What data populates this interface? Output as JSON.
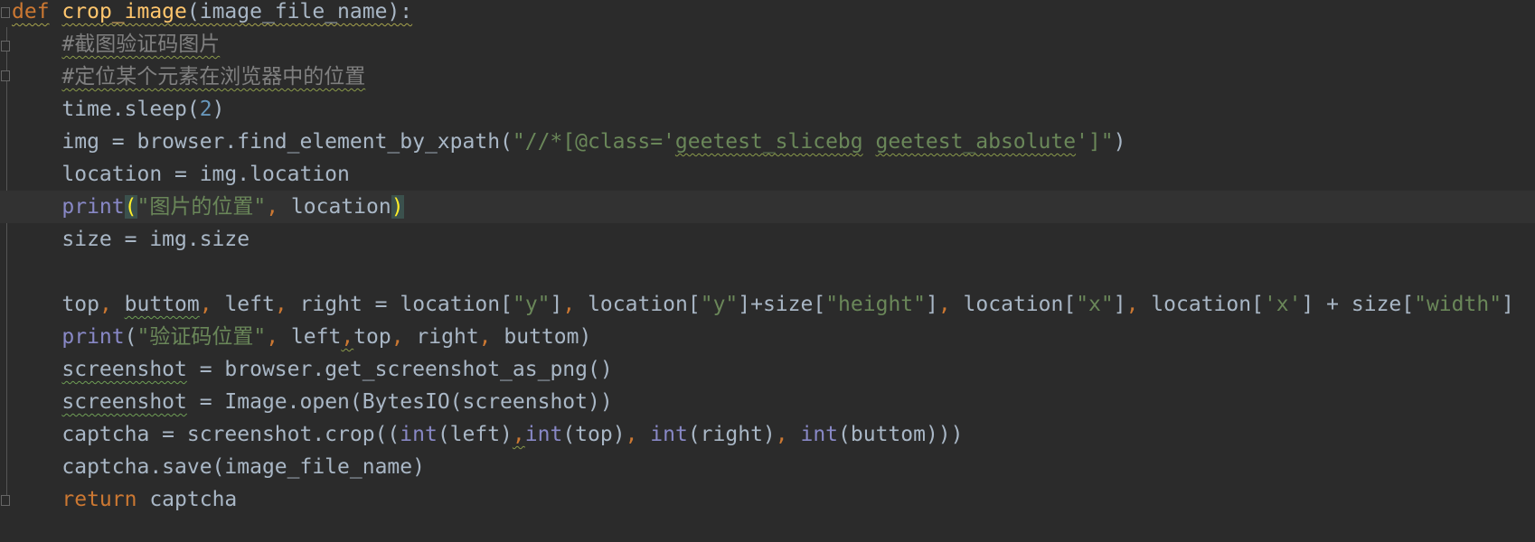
{
  "editor": {
    "language": "python",
    "theme_colors": {
      "background": "#2b2b2b",
      "current_line": "#323232",
      "keyword": "#cc7832",
      "function_name": "#ffc66d",
      "text": "#a9b7c6",
      "comment": "#808080",
      "string": "#6a8759",
      "number": "#6897bb",
      "builtin": "#8888c6",
      "brace_match": "#ffef28"
    },
    "current_line_index": 6,
    "lines": [
      [
        [
          "kw",
          "def",
          "def"
        ],
        [
          "txt",
          " "
        ],
        [
          "fn",
          "crop_image",
          "def"
        ],
        [
          "txt",
          "(image_file_name):",
          "def"
        ]
      ],
      [
        [
          "txt",
          "    "
        ],
        [
          "cm",
          "#截图验证码图片",
          "typo"
        ]
      ],
      [
        [
          "txt",
          "    "
        ],
        [
          "cm",
          "#定位某个元素在浏览器中的位置",
          "typo"
        ]
      ],
      [
        [
          "txt",
          "    time.sleep("
        ],
        [
          "num",
          "2"
        ],
        [
          "txt",
          ")"
        ]
      ],
      [
        [
          "txt",
          "    img = browser.find_element_by_xpath("
        ],
        [
          "str",
          "\"//*[@class='"
        ],
        [
          "str",
          "geetest_slicebg",
          "typo"
        ],
        [
          "str",
          " "
        ],
        [
          "str",
          "geetest_absolute",
          "typo"
        ],
        [
          "str",
          "']\""
        ],
        [
          "txt",
          ")"
        ]
      ],
      [
        [
          "txt",
          "    location = img.location"
        ]
      ],
      [
        [
          "txt",
          "    "
        ],
        [
          "bi",
          "print"
        ],
        [
          "brace",
          "("
        ],
        [
          "str",
          "\"图片的位置\""
        ],
        [
          "comma",
          ","
        ],
        [
          "txt",
          " location"
        ],
        [
          "brace",
          ")"
        ]
      ],
      [
        [
          "txt",
          "    size = img.size"
        ]
      ],
      [],
      [
        [
          "txt",
          "    top"
        ],
        [
          "comma",
          ","
        ],
        [
          "txt",
          " "
        ],
        [
          "txt",
          "buttom",
          "weak"
        ],
        [
          "comma",
          ","
        ],
        [
          "txt",
          " left"
        ],
        [
          "comma",
          ","
        ],
        [
          "txt",
          " right = location["
        ],
        [
          "str",
          "\"y\""
        ],
        [
          "txt",
          "]"
        ],
        [
          "comma",
          ","
        ],
        [
          "txt",
          " location["
        ],
        [
          "str",
          "\"y\""
        ],
        [
          "txt",
          "]+size["
        ],
        [
          "str",
          "\"height\""
        ],
        [
          "txt",
          "]"
        ],
        [
          "comma",
          ","
        ],
        [
          "txt",
          " location["
        ],
        [
          "str",
          "\"x\""
        ],
        [
          "txt",
          "]"
        ],
        [
          "comma",
          ","
        ],
        [
          "txt",
          " location["
        ],
        [
          "str",
          "'x'"
        ],
        [
          "txt",
          "] + size["
        ],
        [
          "str",
          "\"width\""
        ],
        [
          "txt",
          "]"
        ]
      ],
      [
        [
          "txt",
          "    "
        ],
        [
          "bi",
          "print"
        ],
        [
          "txt",
          "("
        ],
        [
          "str",
          "\"验证码位置\""
        ],
        [
          "comma",
          ","
        ],
        [
          "txt",
          " left"
        ],
        [
          "comma",
          ",",
          "typo"
        ],
        [
          "txt",
          "top"
        ],
        [
          "comma",
          ","
        ],
        [
          "txt",
          " right"
        ],
        [
          "comma",
          ","
        ],
        [
          "txt",
          " buttom)"
        ]
      ],
      [
        [
          "txt",
          "    "
        ],
        [
          "txt",
          "screenshot",
          "weak"
        ],
        [
          "txt",
          " = browser.get_screenshot_as_png()"
        ]
      ],
      [
        [
          "txt",
          "    "
        ],
        [
          "txt",
          "screenshot",
          "weak"
        ],
        [
          "txt",
          " = Image.open(BytesIO(screenshot))"
        ]
      ],
      [
        [
          "txt",
          "    captcha = screenshot.crop(("
        ],
        [
          "bi",
          "int"
        ],
        [
          "txt",
          "(left)"
        ],
        [
          "comma",
          ",",
          "typo"
        ],
        [
          "bi",
          "int"
        ],
        [
          "txt",
          "(top)"
        ],
        [
          "comma",
          ","
        ],
        [
          "txt",
          " "
        ],
        [
          "bi",
          "int"
        ],
        [
          "txt",
          "(right)"
        ],
        [
          "comma",
          ","
        ],
        [
          "txt",
          " "
        ],
        [
          "bi",
          "int"
        ],
        [
          "txt",
          "(buttom)))"
        ]
      ],
      [
        [
          "txt",
          "    captcha.save(image_file_name)"
        ]
      ],
      [
        [
          "txt",
          "    "
        ],
        [
          "kw",
          "return"
        ],
        [
          "txt",
          " captcha"
        ]
      ]
    ]
  }
}
